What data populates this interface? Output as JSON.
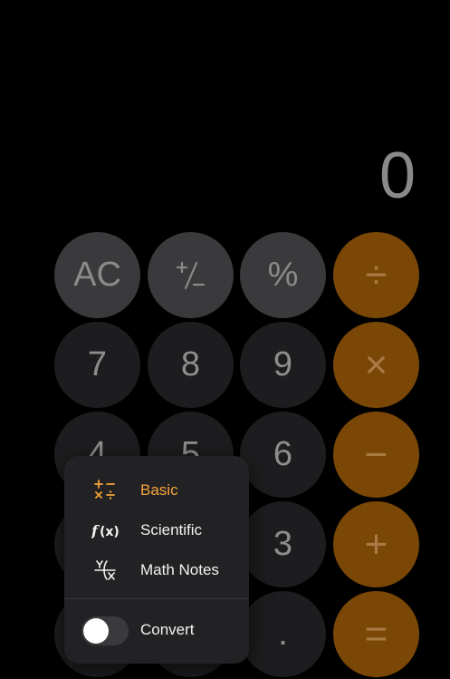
{
  "display": {
    "value": "0"
  },
  "keypad": {
    "ac": "AC",
    "percent": "%",
    "divide": "÷",
    "multiply": "×",
    "minus": "−",
    "plus": "+",
    "equals": "=",
    "seven": "7",
    "eight": "8",
    "nine": "9",
    "four": "4",
    "five": "5",
    "six": "6",
    "three": "3",
    "decimal": "."
  },
  "menu": {
    "basic": "Basic",
    "scientific": "Scientific",
    "math_notes": "Math Notes",
    "convert": "Convert",
    "convert_enabled": false,
    "active_color": "#f5a33a",
    "icons": [
      "basic-operators-icon",
      "function-icon",
      "math-notes-icon"
    ]
  },
  "colors": {
    "operator_bg": "#7a4706",
    "function_bg": "#3a3a3c",
    "number_bg": "#1d1d1f"
  }
}
